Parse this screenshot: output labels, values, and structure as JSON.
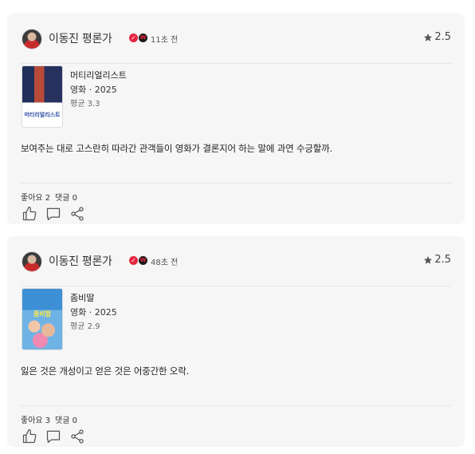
{
  "reviews": [
    {
      "author": "이동진 평론가",
      "badge_icons": [
        "verified-check-icon",
        "critic-badge-icon"
      ],
      "time": "11초 전",
      "rating": "2.5",
      "movie": {
        "title": "머티리얼리스트",
        "meta": "영화 · 2025",
        "average": "평균 3.3",
        "poster_text": "머티리얼리스트"
      },
      "text": "보여주는 대로 고스란히 따라간 관객들이 영화가 결론지어 하는 말에 과연 수긍할까.",
      "likes": "좋아요 2",
      "comments": "댓글 0"
    },
    {
      "author": "이동진 평론가",
      "badge_icons": [
        "verified-check-icon",
        "critic-badge-icon"
      ],
      "time": "48초 전",
      "rating": "2.5",
      "movie": {
        "title": "좀비딸",
        "meta": "영화 · 2025",
        "average": "평균 2.9",
        "poster_text": "좀비딸"
      },
      "text": "잃은 것은 개성이고 얻은 것은 어중간한 오락.",
      "likes": "좋아요 3",
      "comments": "댓글 0"
    }
  ],
  "colors": {
    "card_bg": "#f6f6f6",
    "badge_red": "#e5243f"
  }
}
